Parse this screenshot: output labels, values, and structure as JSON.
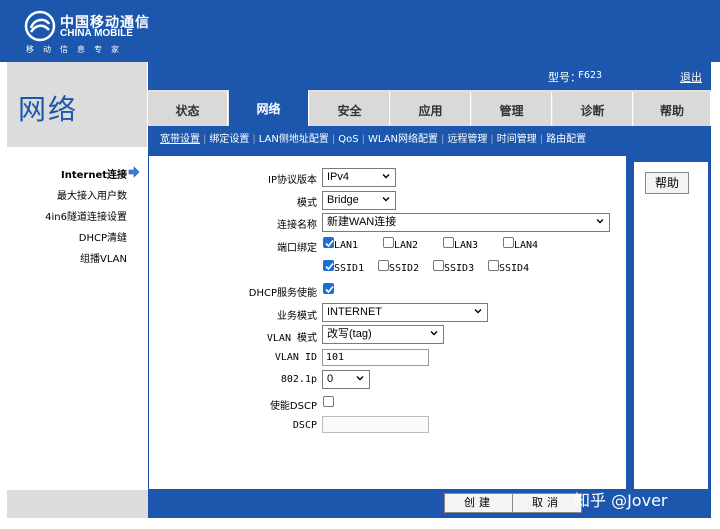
{
  "brand": {
    "name_cn": "中国移动通信",
    "name_en": "CHINA MOBILE",
    "slogan": "移动信息专家"
  },
  "page_title": "网络",
  "header": {
    "model_label": "型号：",
    "model_value": "F623",
    "logout": "退出"
  },
  "tabs": [
    {
      "label": "状态"
    },
    {
      "label": "网络",
      "active": true
    },
    {
      "label": "安全"
    },
    {
      "label": "应用"
    },
    {
      "label": "管理"
    },
    {
      "label": "诊断"
    },
    {
      "label": "帮助"
    }
  ],
  "subnav": [
    "宽带设置",
    "绑定设置",
    "LAN侧地址配置",
    "QoS",
    "WLAN网络配置",
    "远程管理",
    "时间管理",
    "路由配置"
  ],
  "leftnav": [
    {
      "label": "Internet连接",
      "active": true
    },
    {
      "label": "最大接入用户数"
    },
    {
      "label": "4in6隧道连接设置"
    },
    {
      "label": "DHCP清缝"
    },
    {
      "label": "组播VLAN"
    }
  ],
  "help_button": "帮助",
  "form": {
    "ip_version": {
      "label": "IP协议版本",
      "value": "IPv4"
    },
    "mode": {
      "label": "模式",
      "value": "Bridge"
    },
    "connection_name": {
      "label": "连接名称",
      "value": "新建WAN连接"
    },
    "port_binding": {
      "label": "端口绑定",
      "ports": [
        {
          "label": "LAN1",
          "checked": true
        },
        {
          "label": "LAN2",
          "checked": false
        },
        {
          "label": "LAN3",
          "checked": false
        },
        {
          "label": "LAN4",
          "checked": false
        },
        {
          "label": "SSID1",
          "checked": true
        },
        {
          "label": "SSID2",
          "checked": false
        },
        {
          "label": "SSID3",
          "checked": false
        },
        {
          "label": "SSID4",
          "checked": false
        }
      ]
    },
    "dhcp_service": {
      "label": "DHCP服务使能",
      "checked": true
    },
    "service_mode": {
      "label": "业务模式",
      "value": "INTERNET"
    },
    "vlan_mode": {
      "label": "VLAN 模式",
      "value": "改写(tag)"
    },
    "vlan_id": {
      "label": "VLAN ID",
      "value": "101"
    },
    "dot1p": {
      "label": "802.1p",
      "value": "0"
    },
    "enable_dscp": {
      "label": "使能DSCP",
      "checked": false
    },
    "dscp": {
      "label": "DSCP",
      "value": ""
    }
  },
  "buttons": {
    "create": "创建",
    "cancel": "取消"
  },
  "watermark": "知乎 @Jover",
  "colors": {
    "primary": "#1c57ad",
    "checkbox": "#1c6fd1"
  }
}
